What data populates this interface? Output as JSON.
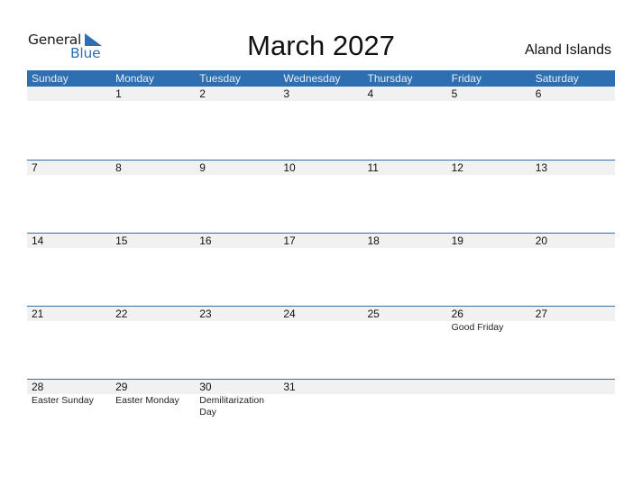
{
  "brand": {
    "line1": "General",
    "line2": "Blue",
    "accent": "#2e6fb1"
  },
  "title": "March 2027",
  "country": "Aland Islands",
  "weekdays": [
    "Sunday",
    "Monday",
    "Tuesday",
    "Wednesday",
    "Thursday",
    "Friday",
    "Saturday"
  ],
  "weeks": [
    [
      {
        "day": "",
        "holiday": ""
      },
      {
        "day": "1",
        "holiday": ""
      },
      {
        "day": "2",
        "holiday": ""
      },
      {
        "day": "3",
        "holiday": ""
      },
      {
        "day": "4",
        "holiday": ""
      },
      {
        "day": "5",
        "holiday": ""
      },
      {
        "day": "6",
        "holiday": ""
      }
    ],
    [
      {
        "day": "7",
        "holiday": ""
      },
      {
        "day": "8",
        "holiday": ""
      },
      {
        "day": "9",
        "holiday": ""
      },
      {
        "day": "10",
        "holiday": ""
      },
      {
        "day": "11",
        "holiday": ""
      },
      {
        "day": "12",
        "holiday": ""
      },
      {
        "day": "13",
        "holiday": ""
      }
    ],
    [
      {
        "day": "14",
        "holiday": ""
      },
      {
        "day": "15",
        "holiday": ""
      },
      {
        "day": "16",
        "holiday": ""
      },
      {
        "day": "17",
        "holiday": ""
      },
      {
        "day": "18",
        "holiday": ""
      },
      {
        "day": "19",
        "holiday": ""
      },
      {
        "day": "20",
        "holiday": ""
      }
    ],
    [
      {
        "day": "21",
        "holiday": ""
      },
      {
        "day": "22",
        "holiday": ""
      },
      {
        "day": "23",
        "holiday": ""
      },
      {
        "day": "24",
        "holiday": ""
      },
      {
        "day": "25",
        "holiday": ""
      },
      {
        "day": "26",
        "holiday": "Good Friday"
      },
      {
        "day": "27",
        "holiday": ""
      }
    ],
    [
      {
        "day": "28",
        "holiday": "Easter Sunday"
      },
      {
        "day": "29",
        "holiday": "Easter Monday"
      },
      {
        "day": "30",
        "holiday": "Demilitarization Day"
      },
      {
        "day": "31",
        "holiday": ""
      },
      {
        "day": "",
        "holiday": ""
      },
      {
        "day": "",
        "holiday": ""
      },
      {
        "day": "",
        "holiday": ""
      }
    ]
  ]
}
